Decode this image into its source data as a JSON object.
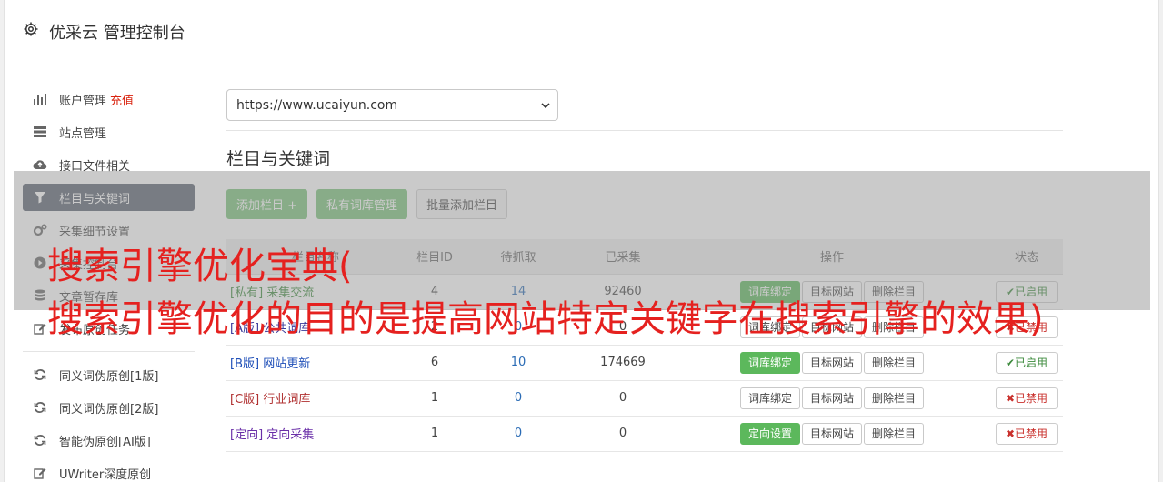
{
  "app": {
    "title": "优采云 管理控制台",
    "icon": "gear-icon"
  },
  "sidebar": {
    "items": [
      {
        "label": "账户管理",
        "extra": "充值",
        "icon": "bar-chart-icon"
      },
      {
        "label": "站点管理",
        "icon": "server-icon"
      },
      {
        "label": "接口文件相关",
        "icon": "cloud-upload-icon"
      },
      {
        "label": "栏目与关键词",
        "icon": "filter-icon",
        "active": true
      },
      {
        "label": "采集细节设置",
        "icon": "gears-icon"
      },
      {
        "label": "采集控制台",
        "icon": "play-circle-icon"
      },
      {
        "label": "文章暂存库",
        "icon": "database-icon"
      },
      {
        "label": "发布原创任务",
        "icon": "edit-icon"
      }
    ],
    "tools": [
      {
        "label": "同义词伪原创[1版]",
        "icon": "refresh-icon"
      },
      {
        "label": "同义词伪原创[2版]",
        "icon": "refresh-icon"
      },
      {
        "label": "智能伪原创[AI版]",
        "icon": "refresh-icon"
      },
      {
        "label": "UWriter深度原创",
        "icon": "edit-icon"
      }
    ]
  },
  "main": {
    "site_select": {
      "value": "https://www.ucaiyun.com"
    },
    "section_title": "栏目与关键词",
    "buttons": {
      "add": "添加栏目 +",
      "private_lib": "私有词库管理",
      "batch_add": "批量添加栏目"
    },
    "table": {
      "headers": [
        "栏目名称",
        "栏目ID",
        "待抓取",
        "已采集",
        "操作",
        "状态"
      ],
      "rows": [
        {
          "tag": "[私有]",
          "name": "采集交流",
          "id": "4",
          "pending": "14",
          "collected": "92460",
          "op1": "词库绑定",
          "op1_green": true,
          "op2": "目标网站",
          "op3": "删除栏目",
          "status": "✔已启用",
          "on": true,
          "tag_class": "t-private"
        },
        {
          "tag": "[A版]",
          "name": "公共词库",
          "id": "2",
          "pending": "0",
          "collected": "0",
          "op1": "词库绑定",
          "op1_green": false,
          "op2": "目标网站",
          "op3": "删除栏目",
          "status": "✖已禁用",
          "on": false,
          "tag_class": "t-a"
        },
        {
          "tag": "[B版]",
          "name": "网站更新",
          "id": "6",
          "pending": "10",
          "collected": "174669",
          "op1": "词库绑定",
          "op1_green": true,
          "op2": "目标网站",
          "op3": "删除栏目",
          "status": "✔已启用",
          "on": true,
          "tag_class": "t-b"
        },
        {
          "tag": "[C版]",
          "name": "行业词库",
          "id": "1",
          "pending": "0",
          "collected": "0",
          "op1": "词库绑定",
          "op1_green": false,
          "op2": "目标网站",
          "op3": "删除栏目",
          "status": "✖已禁用",
          "on": false,
          "tag_class": "t-c"
        },
        {
          "tag": "[定向]",
          "name": "定向采集",
          "id": "1",
          "pending": "0",
          "collected": "0",
          "op1": "定向设置",
          "op1_green": true,
          "op2": "目标网站",
          "op3": "删除栏目",
          "status": "✖已禁用",
          "on": false,
          "tag_class": "t-dir"
        }
      ]
    }
  },
  "overlay": {
    "line1": "搜索引擎优化宝典(",
    "line2": "搜索引擎优化的目的是提高网站特定关键字在搜索引擎的效果)"
  },
  "colors": {
    "accent_green": "#5cb85c",
    "active_nav": "#5a6270",
    "headline_red": "#e5211f"
  }
}
